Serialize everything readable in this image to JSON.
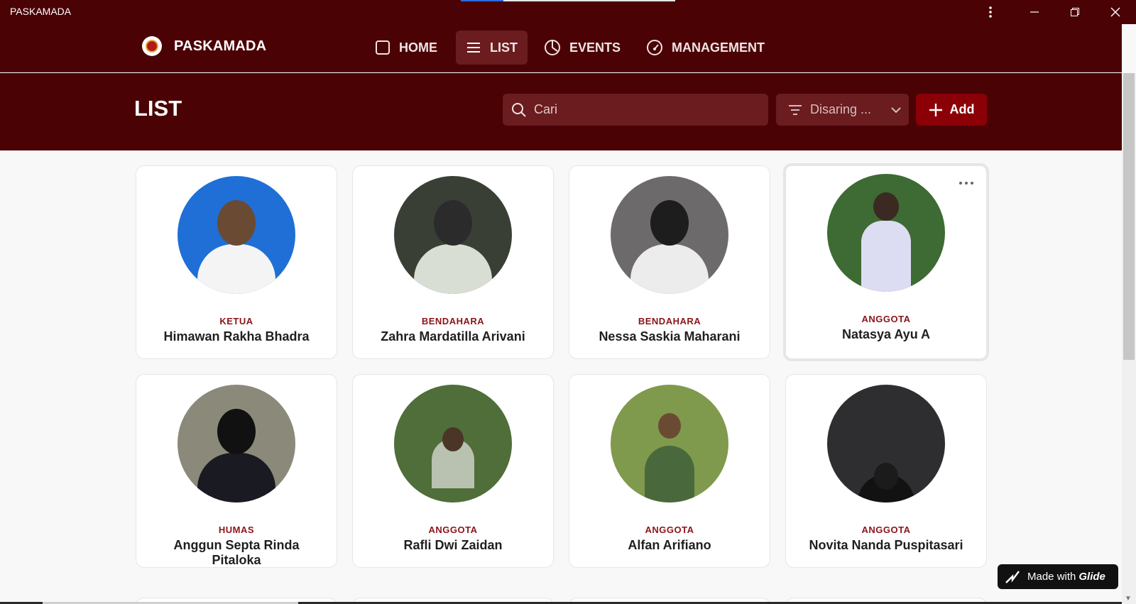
{
  "window": {
    "title": "PASKAMADA"
  },
  "nav": {
    "brand": "PASKAMADA",
    "items": [
      {
        "label": "HOME",
        "icon": "square-icon"
      },
      {
        "label": "LIST",
        "icon": "list-icon",
        "active": true
      },
      {
        "label": "EVENTS",
        "icon": "pie-icon"
      },
      {
        "label": "MANAGEMENT",
        "icon": "gauge-icon"
      }
    ]
  },
  "header": {
    "title": "LIST",
    "search_placeholder": "Cari",
    "filter_label": "Disaring ...",
    "add_label": "Add"
  },
  "members": [
    {
      "role": "KETUA",
      "name": "Himawan Rakha Bhadra"
    },
    {
      "role": "BENDAHARA",
      "name": "Zahra Mardatilla Arivani"
    },
    {
      "role": "BENDAHARA",
      "name": "Nessa Saskia Maharani"
    },
    {
      "role": "ANGGOTA",
      "name": "Natasya Ayu A"
    },
    {
      "role": "HUMAS",
      "name": "Anggun Septa Rinda Pitaloka"
    },
    {
      "role": "ANGGOTA",
      "name": "Rafli Dwi Zaidan"
    },
    {
      "role": "ANGGOTA",
      "name": "Alfan Arifiano"
    },
    {
      "role": "ANGGOTA",
      "name": "Novita Nanda Puspitasari"
    }
  ],
  "footer_badge": {
    "prefix": "Made with",
    "brand": "Glide"
  },
  "colors": {
    "primary": "#4a0205",
    "accent": "#8b0007",
    "role_text": "#8b1418"
  }
}
